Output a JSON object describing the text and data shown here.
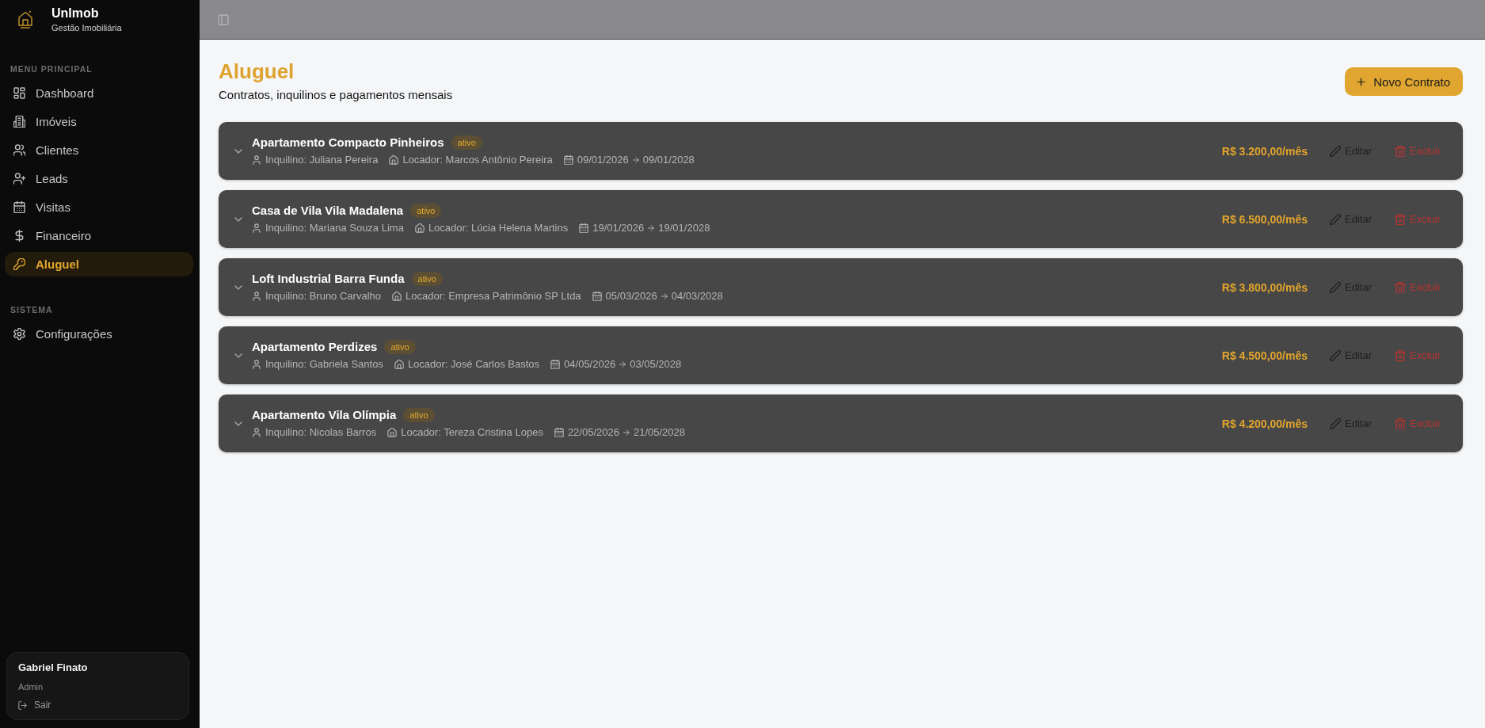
{
  "sidebar": {
    "brand": {
      "name": "UnImob",
      "tagline": "Gestão Imobiliária"
    },
    "sections": [
      {
        "title": "MENU PRINCIPAL",
        "items": [
          {
            "label": "Dashboard",
            "selected": false
          },
          {
            "label": "Imóveis",
            "selected": false
          },
          {
            "label": "Clientes",
            "selected": false
          },
          {
            "label": "Leads",
            "selected": false
          },
          {
            "label": "Visitas",
            "selected": false
          },
          {
            "label": "Financeiro",
            "selected": false
          },
          {
            "label": "Aluguel",
            "selected": true
          }
        ]
      },
      {
        "title": "SISTEMA",
        "items": [
          {
            "label": "Configurações",
            "selected": false
          }
        ]
      }
    ],
    "user": {
      "name": "Gabriel Finato",
      "role": "Admin",
      "logout": "Sair"
    }
  },
  "page": {
    "title": "Aluguel",
    "subtitle": "Contratos, inquilinos e pagamentos mensais",
    "new_button": "Novo Contrato"
  },
  "contracts": [
    {
      "property": "Apartamento Compacto Pinheiros",
      "status": "ativo",
      "tenant": "Inquilino: Juliana Pereira",
      "landlord": "Locador: Marcos Antônio Pereira",
      "start": "09/01/2026",
      "end": "09/01/2028",
      "rent": "R$ 3.200,00/mês",
      "edit": "Editar",
      "delete": "Excluir"
    },
    {
      "property": "Casa de Vila Vila Madalena",
      "status": "ativo",
      "tenant": "Inquilino: Mariana Souza Lima",
      "landlord": "Locador: Lúcia Helena Martins",
      "start": "19/01/2026",
      "end": "19/01/2028",
      "rent": "R$ 6.500,00/mês",
      "edit": "Editar",
      "delete": "Excluir"
    },
    {
      "property": "Loft Industrial Barra Funda",
      "status": "ativo",
      "tenant": "Inquilino: Bruno Carvalho",
      "landlord": "Locador: Empresa Patrimônio SP Ltda",
      "start": "05/03/2026",
      "end": "04/03/2028",
      "rent": "R$ 3.800,00/mês",
      "edit": "Editar",
      "delete": "Excluir"
    },
    {
      "property": "Apartamento Perdizes",
      "status": "ativo",
      "tenant": "Inquilino: Gabriela Santos",
      "landlord": "Locador: José Carlos Bastos",
      "start": "04/05/2026",
      "end": "03/05/2028",
      "rent": "R$ 4.500,00/mês",
      "edit": "Editar",
      "delete": "Excluir"
    },
    {
      "property": "Apartamento Vila Olímpia",
      "status": "ativo",
      "tenant": "Inquilino: Nicolas Barros",
      "landlord": "Locador: Tereza Cristina Lopes",
      "start": "22/05/2026",
      "end": "21/05/2028",
      "rent": "R$ 4.200,00/mês",
      "edit": "Editar",
      "delete": "Excluir"
    }
  ]
}
